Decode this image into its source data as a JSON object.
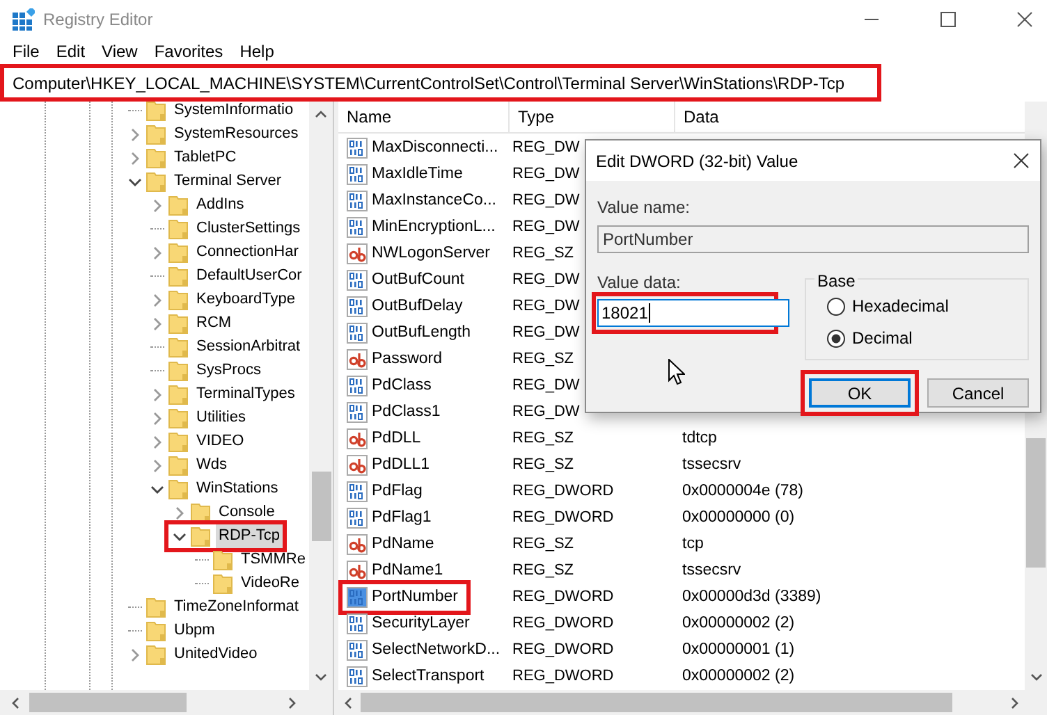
{
  "window": {
    "title": "Registry Editor"
  },
  "menu": [
    "File",
    "Edit",
    "View",
    "Favorites",
    "Help"
  ],
  "address_bar": {
    "path": "Computer\\HKEY_LOCAL_MACHINE\\SYSTEM\\CurrentControlSet\\Control\\Terminal Server\\WinStations\\RDP-Tcp",
    "highlight_box": true
  },
  "tree": [
    {
      "label": "SystemInformatio",
      "kind": "leaf",
      "selected": false,
      "highlight_box": false
    },
    {
      "label": "SystemResources",
      "kind": "branch",
      "expanded": false,
      "selected": false,
      "highlight_box": false
    },
    {
      "label": "TabletPC",
      "kind": "branch",
      "expanded": false,
      "selected": false,
      "highlight_box": false
    },
    {
      "label": "Terminal Server",
      "kind": "branch",
      "expanded": true,
      "selected": false,
      "highlight_box": false,
      "children": [
        {
          "label": "AddIns",
          "kind": "branch",
          "expanded": false,
          "selected": false,
          "highlight_box": false
        },
        {
          "label": "ClusterSettings",
          "kind": "leaf",
          "selected": false,
          "highlight_box": false
        },
        {
          "label": "ConnectionHar",
          "kind": "branch",
          "expanded": false,
          "selected": false,
          "highlight_box": false
        },
        {
          "label": "DefaultUserCor",
          "kind": "leaf",
          "selected": false,
          "highlight_box": false
        },
        {
          "label": "KeyboardType",
          "kind": "branch",
          "expanded": false,
          "selected": false,
          "highlight_box": false
        },
        {
          "label": "RCM",
          "kind": "branch",
          "expanded": false,
          "selected": false,
          "highlight_box": false
        },
        {
          "label": "SessionArbitrat",
          "kind": "leaf",
          "selected": false,
          "highlight_box": false
        },
        {
          "label": "SysProcs",
          "kind": "leaf",
          "selected": false,
          "highlight_box": false
        },
        {
          "label": "TerminalTypes",
          "kind": "branch",
          "expanded": false,
          "selected": false,
          "highlight_box": false
        },
        {
          "label": "Utilities",
          "kind": "branch",
          "expanded": false,
          "selected": false,
          "highlight_box": false
        },
        {
          "label": "VIDEO",
          "kind": "branch",
          "expanded": false,
          "selected": false,
          "highlight_box": false
        },
        {
          "label": "Wds",
          "kind": "branch",
          "expanded": false,
          "selected": false,
          "highlight_box": false
        },
        {
          "label": "WinStations",
          "kind": "branch",
          "expanded": true,
          "selected": false,
          "highlight_box": false,
          "children": [
            {
              "label": "Console",
              "kind": "branch",
              "expanded": false,
              "selected": false,
              "highlight_box": false
            },
            {
              "label": "RDP-Tcp",
              "kind": "branch",
              "expanded": true,
              "selected": true,
              "highlight_box": true,
              "children": [
                {
                  "label": "TSMMRe",
                  "kind": "leaf",
                  "selected": false,
                  "highlight_box": false
                },
                {
                  "label": "VideoRe",
                  "kind": "leaf",
                  "selected": false,
                  "highlight_box": false
                }
              ]
            }
          ]
        }
      ]
    },
    {
      "label": "TimeZoneInformat",
      "kind": "leaf",
      "selected": false,
      "highlight_box": false
    },
    {
      "label": "Ubpm",
      "kind": "leaf",
      "selected": false,
      "highlight_box": false
    },
    {
      "label": "UnitedVideo",
      "kind": "branch",
      "expanded": false,
      "selected": false,
      "highlight_box": false
    }
  ],
  "values": {
    "columns": [
      "Name",
      "Type",
      "Data"
    ],
    "rows": [
      {
        "name": "MaxDisconnecti...",
        "kind": "dword",
        "type": "REG_DW",
        "selected": false,
        "highlight_box": false
      },
      {
        "name": "MaxIdleTime",
        "kind": "dword",
        "type": "REG_DW",
        "selected": false,
        "highlight_box": false
      },
      {
        "name": "MaxInstanceCo...",
        "kind": "dword",
        "type": "REG_DW",
        "selected": false,
        "highlight_box": false
      },
      {
        "name": "MinEncryptionL...",
        "kind": "dword",
        "type": "REG_DW",
        "selected": false,
        "highlight_box": false
      },
      {
        "name": "NWLogonServer",
        "kind": "string",
        "type": "REG_SZ",
        "selected": false,
        "highlight_box": false
      },
      {
        "name": "OutBufCount",
        "kind": "dword",
        "type": "REG_DW",
        "selected": false,
        "highlight_box": false
      },
      {
        "name": "OutBufDelay",
        "kind": "dword",
        "type": "REG_DW",
        "selected": false,
        "highlight_box": false
      },
      {
        "name": "OutBufLength",
        "kind": "dword",
        "type": "REG_DW",
        "selected": false,
        "highlight_box": false
      },
      {
        "name": "Password",
        "kind": "string",
        "type": "REG_SZ",
        "selected": false,
        "highlight_box": false
      },
      {
        "name": "PdClass",
        "kind": "dword",
        "type": "REG_DW",
        "selected": false,
        "highlight_box": false
      },
      {
        "name": "PdClass1",
        "kind": "dword",
        "type": "REG_DW",
        "selected": false,
        "highlight_box": false
      },
      {
        "name": "PdDLL",
        "kind": "string",
        "type": "REG_SZ",
        "data": "tdtcp",
        "selected": false,
        "highlight_box": false
      },
      {
        "name": "PdDLL1",
        "kind": "string",
        "type": "REG_SZ",
        "data": "tssecsrv",
        "selected": false,
        "highlight_box": false
      },
      {
        "name": "PdFlag",
        "kind": "dword",
        "type": "REG_DWORD",
        "data": "0x0000004e (78)",
        "selected": false,
        "highlight_box": false
      },
      {
        "name": "PdFlag1",
        "kind": "dword",
        "type": "REG_DWORD",
        "data": "0x00000000 (0)",
        "selected": false,
        "highlight_box": false
      },
      {
        "name": "PdName",
        "kind": "string",
        "type": "REG_SZ",
        "data": "tcp",
        "selected": false,
        "highlight_box": false
      },
      {
        "name": "PdName1",
        "kind": "string",
        "type": "REG_SZ",
        "data": "tssecsrv",
        "selected": false,
        "highlight_box": false
      },
      {
        "name": "PortNumber",
        "kind": "dword",
        "type": "REG_DWORD",
        "data": "0x00000d3d (3389)",
        "selected": true,
        "highlight_box": true
      },
      {
        "name": "SecurityLayer",
        "kind": "dword",
        "type": "REG_DWORD",
        "data": "0x00000002 (2)",
        "selected": false,
        "highlight_box": false
      },
      {
        "name": "SelectNetworkD...",
        "kind": "dword",
        "type": "REG_DWORD",
        "data": "0x00000001 (1)",
        "selected": false,
        "highlight_box": false
      },
      {
        "name": "SelectTransport",
        "kind": "dword",
        "type": "REG_DWORD",
        "data": "0x00000002 (2)",
        "selected": false,
        "highlight_box": false
      }
    ]
  },
  "dialog": {
    "title": "Edit DWORD (32-bit) Value",
    "value_name_label": "Value name:",
    "value_name": "PortNumber",
    "value_data_label": "Value data:",
    "value_data": "18021",
    "value_data_highlight_box": true,
    "base_label": "Base",
    "base_options": [
      {
        "label": "Hexadecimal",
        "selected": false
      },
      {
        "label": "Decimal",
        "selected": true
      }
    ],
    "buttons": [
      {
        "label": "OK",
        "default": true,
        "highlight_box": true
      },
      {
        "label": "Cancel",
        "default": false,
        "highlight_box": false
      }
    ]
  }
}
